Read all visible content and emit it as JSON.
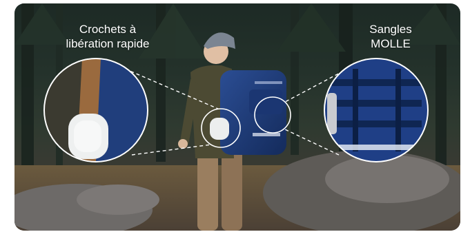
{
  "callouts": {
    "hooks": {
      "line1": "Crochets à",
      "line2": "libération rapide"
    },
    "molle": {
      "line1": "Sangles",
      "line2": "MOLLE"
    }
  },
  "icons": [
    "quick-release-hook-zoom",
    "molle-webbing-zoom"
  ],
  "colors": {
    "backpack_blue": "#1f3c78",
    "callout_white": "#ffffff",
    "forest_dark": "#1d2a25"
  }
}
